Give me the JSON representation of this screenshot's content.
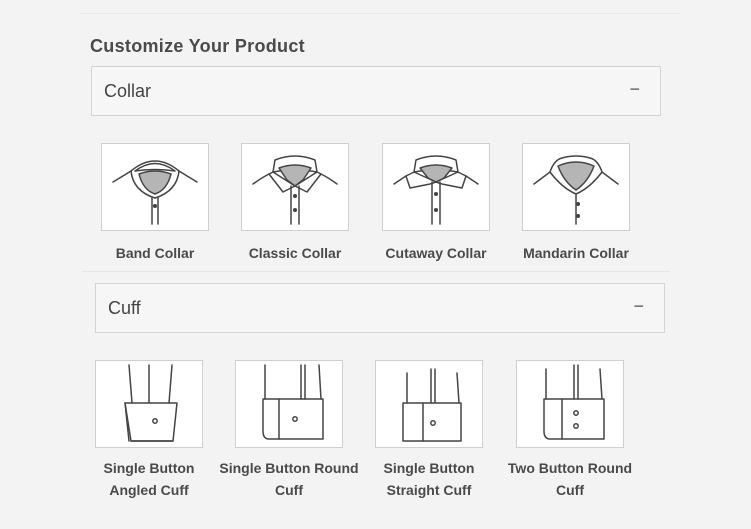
{
  "customize": {
    "heading": "Customize Your Product"
  },
  "sections": {
    "collar": {
      "title": "Collar",
      "toggle": "−",
      "options": [
        "Band Collar",
        "Classic Collar",
        "Cutaway Collar",
        "Mandarin Collar"
      ]
    },
    "cuff": {
      "title": "Cuff",
      "toggle": "−",
      "options": [
        [
          "Single Button",
          "Angled Cuff"
        ],
        [
          "Single Button Round",
          "Cuff"
        ],
        [
          "Single Button",
          "Straight Cuff"
        ],
        [
          "Two Button Round",
          "Cuff"
        ]
      ]
    }
  },
  "icons": {
    "collar": [
      "band-collar-icon",
      "classic-collar-icon",
      "cutaway-collar-icon",
      "mandarin-collar-icon"
    ],
    "cuff": [
      "single-button-angled-cuff-icon",
      "single-button-round-cuff-icon",
      "single-button-straight-cuff-icon",
      "two-button-round-cuff-icon"
    ]
  },
  "colors": {
    "page_bg": "#f3f3f3",
    "card_bg": "#ffffff",
    "border": "#cfcfcf",
    "text": "#4a4a4a",
    "collar_fill": "#b5b5b5"
  }
}
